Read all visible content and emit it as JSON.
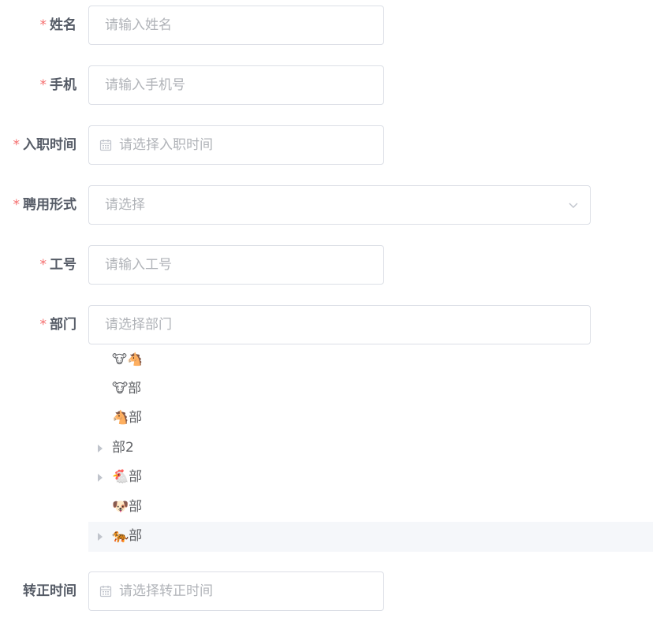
{
  "form": {
    "fields": {
      "name": {
        "label": "姓名",
        "placeholder": "请输入姓名",
        "required": true
      },
      "phone": {
        "label": "手机",
        "placeholder": "请输入手机号",
        "required": true
      },
      "hire_date": {
        "label": "入职时间",
        "placeholder": "请选择入职时间",
        "required": true,
        "icon": "calendar-icon"
      },
      "employment": {
        "label": "聘用形式",
        "placeholder": "请选择",
        "required": true,
        "icon": "chevron-down-icon"
      },
      "employee_no": {
        "label": "工号",
        "placeholder": "请输入工号",
        "required": true
      },
      "department": {
        "label": "部门",
        "placeholder": "请选择部门",
        "required": true
      },
      "regular_date": {
        "label": "转正时间",
        "placeholder": "请选择转正时间",
        "required": false,
        "icon": "calendar-icon"
      }
    },
    "required_mark": "*",
    "department_tree": [
      {
        "label": "🐮🐴",
        "expandable": false
      },
      {
        "label": "🐮部",
        "expandable": false
      },
      {
        "label": "🐴部",
        "expandable": false
      },
      {
        "label": "部2",
        "expandable": true
      },
      {
        "label": "🐔部",
        "expandable": true
      },
      {
        "label": "🐶部",
        "expandable": false
      },
      {
        "label": "🐅部",
        "expandable": true,
        "highlighted": true
      }
    ]
  },
  "colors": {
    "required": "#f56c6c",
    "border": "#dcdfe6",
    "placeholder": "#b0b3b8",
    "highlight_bg": "#f5f7fa"
  }
}
